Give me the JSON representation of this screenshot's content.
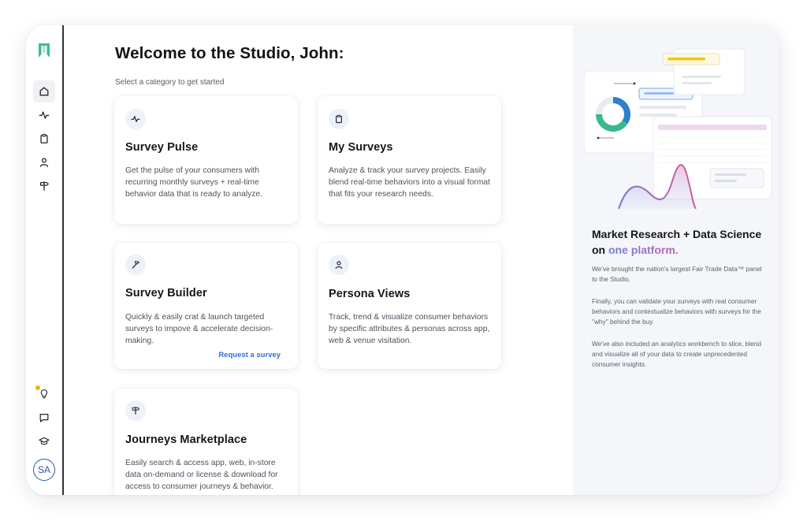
{
  "page": {
    "title": "Welcome to the Studio, John:",
    "subtitle": "Select a category to get started"
  },
  "sidebar": {
    "logo": "studio-logo",
    "nav": [
      {
        "name": "home",
        "icon": "home-icon",
        "active": true
      },
      {
        "name": "pulse",
        "icon": "pulse-icon",
        "active": false
      },
      {
        "name": "surveys",
        "icon": "clipboard-icon",
        "active": false
      },
      {
        "name": "personas",
        "icon": "person-icon",
        "active": false
      },
      {
        "name": "journeys",
        "icon": "signpost-icon",
        "active": false
      }
    ],
    "bottom": [
      {
        "name": "tips",
        "icon": "lightbulb-icon",
        "has_notification": true
      },
      {
        "name": "messages",
        "icon": "chat-icon"
      },
      {
        "name": "learn",
        "icon": "graduation-cap-icon"
      }
    ],
    "avatar_initials": "SA"
  },
  "cards": [
    {
      "title": "Survey Pulse",
      "icon": "pulse-icon",
      "description": "Get the pulse of your consumers with recurring monthly surveys + real-time behavior data that is ready to analyze."
    },
    {
      "title": "My Surveys",
      "icon": "clipboard-icon",
      "description": "Analyze & track your survey projects. Easily blend real-time behaviors into a visual format that fits your research needs."
    },
    {
      "title": "Survey Builder",
      "icon": "hammer-icon",
      "description": "Quickly & easily crat & launch targeted surveys to impove & accelerate decision-making.",
      "link": "Request a survey"
    },
    {
      "title": "Persona Views",
      "icon": "person-icon",
      "description": "Track, trend & visualize consumer behaviors by specific attributes & personas across app, web & venue visitation."
    },
    {
      "title": "Journeys Marketplace",
      "icon": "signpost-icon",
      "description": "Easily search & access app, web, in-store data on-demand or license & download for access to consumer journeys & behavior."
    }
  ],
  "panel": {
    "heading_plain": "Market Research + Data Science on",
    "heading_accent": "one platform.",
    "paragraphs": [
      "We've brought the nation's largest Fair Trade Data™ panel to the Studio.",
      "Finally, you can validate your surveys with real consumer behaviors and contextualize behaviors with surveys for the \"why\" behind the buy.",
      "We've also included an analytics workbench to slice, blend and visualize all of your data to create unprecedented consumer insights."
    ]
  },
  "colors": {
    "accent_blue": "#2f6fd6",
    "logo_green": "#3bbf8e",
    "highlight_yellow": "#f5c518",
    "heading_gradient_start": "#6f7fe6",
    "heading_gradient_end": "#c45fb4"
  }
}
